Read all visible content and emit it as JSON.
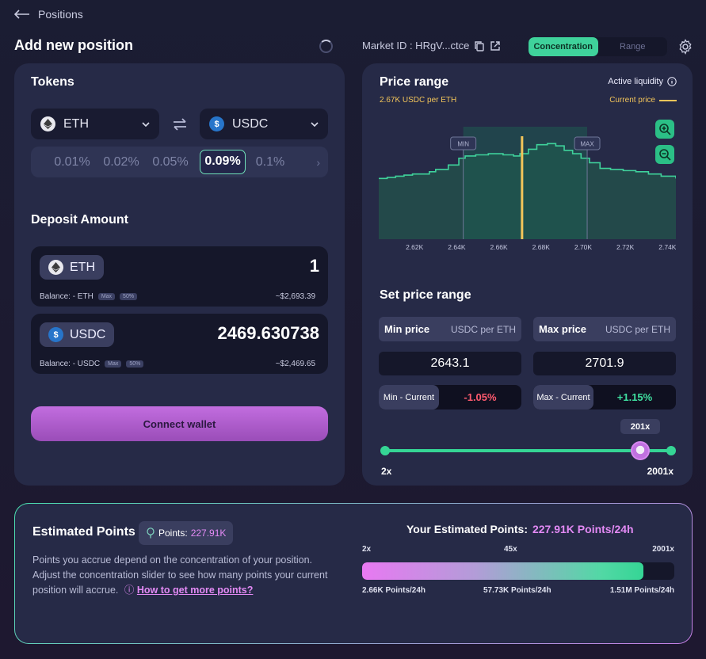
{
  "nav": {
    "back_label": "Positions"
  },
  "page": {
    "title": "Add new position"
  },
  "market": {
    "label": "Market ID : HRgV...ctce"
  },
  "mode_toggle": {
    "options": [
      "Concentration",
      "Range"
    ],
    "selected": "Concentration"
  },
  "tokens": {
    "title": "Tokens",
    "token_a": "ETH",
    "token_b": "USDC",
    "fee_tiers": [
      "0.01%",
      "0.02%",
      "0.05%",
      "0.09%",
      "0.1%"
    ],
    "selected_fee": "0.09%"
  },
  "deposit": {
    "title": "Deposit Amount",
    "rows": [
      {
        "token": "ETH",
        "amount": "1",
        "balance": "Balance: - ETH",
        "max": "Max",
        "half": "50%",
        "usd": "~$2,693.39"
      },
      {
        "token": "USDC",
        "amount": "2469.630738",
        "balance": "Balance: - USDC",
        "max": "Max",
        "half": "50%",
        "usd": "~$2,469.65"
      }
    ]
  },
  "connect_wallet": "Connect wallet",
  "price_range": {
    "title": "Price range",
    "subtitle": "2.67K USDC per ETH",
    "active_liquidity": "Active liquidity",
    "current_price_label": "Current price",
    "min_marker": "MIN",
    "max_marker": "MAX"
  },
  "chart_data": {
    "type": "area",
    "title": "Price range",
    "xlabel": "",
    "ylabel": "",
    "x_ticks": [
      "2.62K",
      "2.64K",
      "2.66K",
      "2.68K",
      "2.70K",
      "2.72K",
      "2.74K"
    ],
    "xlim": [
      2.603,
      2.744
    ],
    "ylim": [
      0,
      1
    ],
    "x": [
      2.603,
      2.607,
      2.611,
      2.615,
      2.619,
      2.623,
      2.627,
      2.63,
      2.636,
      2.641,
      2.644,
      2.649,
      2.655,
      2.662,
      2.667,
      2.67,
      2.674,
      2.678,
      2.683,
      2.687,
      2.691,
      2.695,
      2.699,
      2.703,
      2.708,
      2.713,
      2.719,
      2.725,
      2.731,
      2.737,
      2.744
    ],
    "y": [
      0.54,
      0.55,
      0.56,
      0.57,
      0.58,
      0.58,
      0.6,
      0.62,
      0.66,
      0.72,
      0.74,
      0.75,
      0.76,
      0.75,
      0.74,
      0.76,
      0.8,
      0.84,
      0.85,
      0.83,
      0.79,
      0.76,
      0.72,
      0.68,
      0.63,
      0.62,
      0.61,
      0.6,
      0.58,
      0.56,
      0.54
    ],
    "current_price": 2.671,
    "min_price": 2.6431,
    "max_price": 2.7019,
    "colors": {
      "area": "#1f5a50",
      "line": "#3fd29b",
      "current": "#f3c55a"
    }
  },
  "set_price_range": {
    "title": "Set price range",
    "min": {
      "label": "Min price",
      "unit": "USDC per ETH",
      "value": "2643.1",
      "diff_label": "Min - Current",
      "diff": "-1.05%"
    },
    "max": {
      "label": "Max price",
      "unit": "USDC per ETH",
      "value": "2701.9",
      "diff_label": "Max - Current",
      "diff": "+1.15%"
    }
  },
  "leverage": {
    "current": "201x",
    "min": "2x",
    "max": "2001x",
    "fraction": 0.9
  },
  "estimated": {
    "title": "Estimated Points",
    "badge_label": "Points:",
    "badge_value": "227.91K",
    "desc": "Points you accrue depend on the concentration of your position. Adjust the concentration slider to see how many points your current position will accrue.",
    "link": "How to get more points?",
    "your_label": "Your Estimated Points:",
    "your_value": "227.91K Points/24h",
    "bar_top": [
      "2x",
      "45x",
      "2001x"
    ],
    "bar_bottom": [
      "2.66K Points/24h",
      "57.73K Points/24h",
      "1.51M Points/24h"
    ],
    "bar_fraction": 0.9
  }
}
